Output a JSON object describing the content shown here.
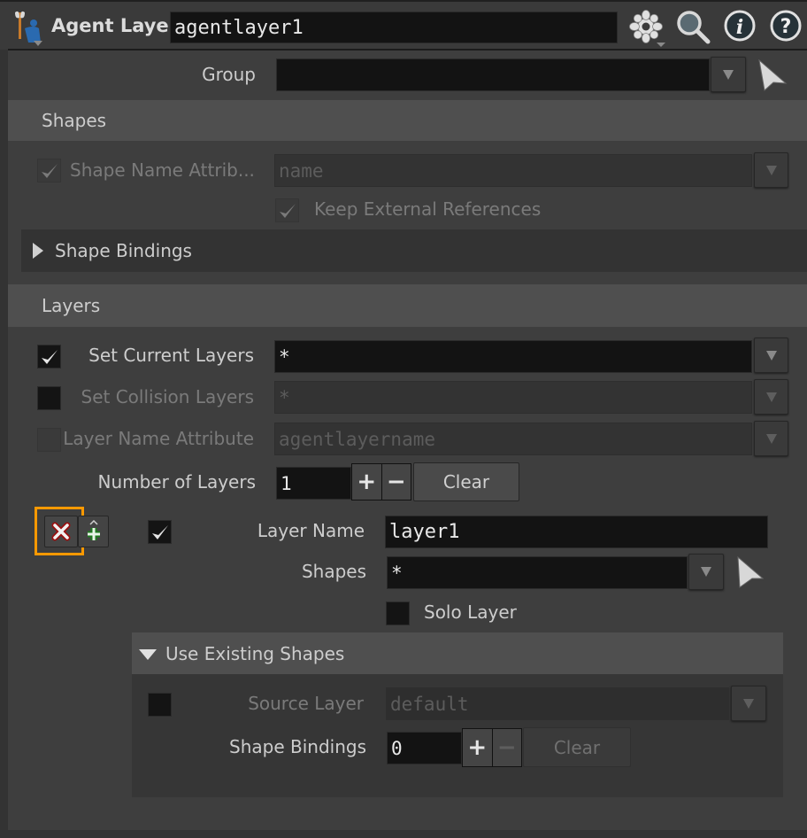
{
  "header": {
    "node_type_label": "Agent Layer",
    "node_name": "agentlayer1",
    "icons": [
      "agent-node-icon",
      "gear-icon",
      "search-icon",
      "info-icon",
      "help-icon"
    ]
  },
  "group": {
    "label": "Group",
    "value": ""
  },
  "shapes_section": {
    "title": "Shapes",
    "shape_name_attrib": {
      "label": "Shape Name Attrib...",
      "value": "name",
      "checked": true,
      "enabled": false
    },
    "keep_external_refs": {
      "label": "Keep External References",
      "checked": true,
      "enabled": false
    },
    "shape_bindings_folder": {
      "label": "Shape Bindings",
      "expanded": false
    }
  },
  "layers_section": {
    "title": "Layers",
    "set_current_layers": {
      "label": "Set Current Layers",
      "value": "*",
      "checked": true
    },
    "set_collision_layers": {
      "label": "Set Collision Layers",
      "value": "*",
      "checked": false
    },
    "layer_name_attribute": {
      "label": "Layer Name Attribute",
      "value": "agentlayername",
      "checked": false
    },
    "number_of_layers": {
      "label": "Number of Layers",
      "value": "1",
      "plus": "+",
      "minus": "−",
      "clear_label": "Clear"
    },
    "layer_item": {
      "enabled_checked": true,
      "layer_name": {
        "label": "Layer Name",
        "value": "layer1"
      },
      "shapes": {
        "label": "Shapes",
        "value": "*"
      },
      "solo_layer": {
        "label": "Solo Layer",
        "checked": false
      },
      "use_existing_shapes": {
        "title": "Use Existing Shapes",
        "expanded": true,
        "source_layer": {
          "label": "Source Layer",
          "value": "default",
          "checked": false
        },
        "shape_bindings": {
          "label": "Shape Bindings",
          "value": "0",
          "plus": "+",
          "minus": "−",
          "clear_label": "Clear"
        }
      }
    }
  },
  "colors": {
    "highlight": "#ff9900",
    "remove_red": "#9a1010",
    "add_green": "#1f7a1f"
  }
}
